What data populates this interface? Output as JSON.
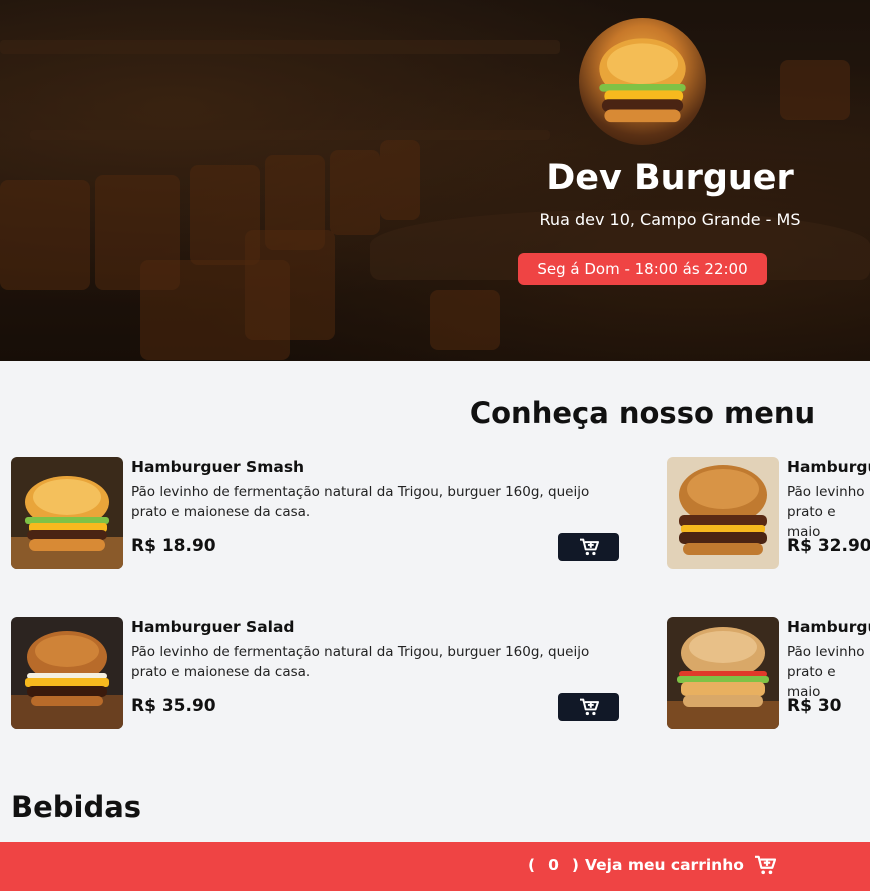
{
  "header": {
    "title": "Dev Burguer",
    "address": "Rua dev 10, Campo Grande - MS",
    "hours": "Seg á Dom - 18:00 ás 22:00"
  },
  "menu": {
    "title": "Conheça nosso menu",
    "products": [
      {
        "name": "Hamburguer Smash",
        "description": "Pão levinho de fermentação natural da Trigou, burguer 160g, queijo prato e maionese da casa.",
        "price": "R$ 18.90",
        "image_icon": "burger-photo"
      },
      {
        "name": "Hamburgu",
        "description": "Pão levinho prato e maio",
        "price": "R$ 32.90",
        "image_icon": "burger-photo"
      },
      {
        "name": "Hamburguer Salad",
        "description": "Pão levinho de fermentação natural da Trigou, burguer 160g, queijo prato e maionese da casa.",
        "price": "R$ 35.90",
        "image_icon": "burger-photo"
      },
      {
        "name": "Hamburgu",
        "description": "Pão levinho prato e maio",
        "price": "R$ 30",
        "image_icon": "burger-photo"
      }
    ],
    "add_to_cart_icon": "cart-plus-icon"
  },
  "drinks": {
    "title": "Bebidas"
  },
  "footer": {
    "open_paren": "(",
    "cart_count": "0",
    "close_paren": ")",
    "cart_label": "Veja meu carrinho",
    "cart_icon": "cart-icon"
  },
  "colors": {
    "accent": "#ef4444",
    "dark": "#111827",
    "page_bg": "#f3f4f6"
  }
}
